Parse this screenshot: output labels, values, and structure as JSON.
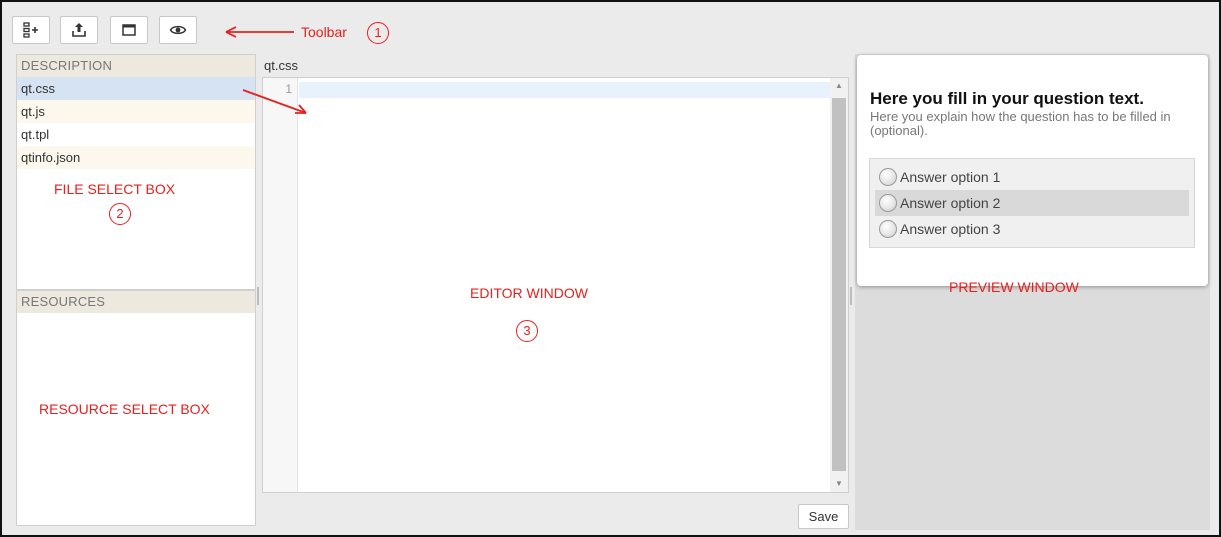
{
  "toolbar": {
    "buttons": [
      {
        "icon": "add-item-icon"
      },
      {
        "icon": "upload-icon"
      },
      {
        "icon": "window-icon"
      },
      {
        "icon": "eye-icon"
      }
    ]
  },
  "file_panel": {
    "header": "DESCRIPTION",
    "files": [
      "qt.css",
      "qt.js",
      "qt.tpl",
      "qtinfo.json"
    ],
    "selected": "qt.css"
  },
  "resource_panel": {
    "header": "RESOURCES"
  },
  "editor": {
    "filename": "qt.css",
    "line_number": "1",
    "save_label": "Save"
  },
  "preview": {
    "question_title": "Here you fill in your question text.",
    "question_explanation": "Here you explain how the question has to be filled in (optional).",
    "options": [
      "Answer option 1",
      "Answer option 2",
      "Answer option 3"
    ]
  },
  "annotations": {
    "toolbar_label": "Toolbar",
    "toolbar_number": "1",
    "file_select_label": "FILE SELECT BOX",
    "file_select_number": "2",
    "editor_label": "EDITOR WINDOW",
    "editor_number": "3",
    "preview_label": "PREVIEW WINDOW",
    "resource_label": "RESOURCE SELECT BOX",
    "color": "#e8201d"
  }
}
